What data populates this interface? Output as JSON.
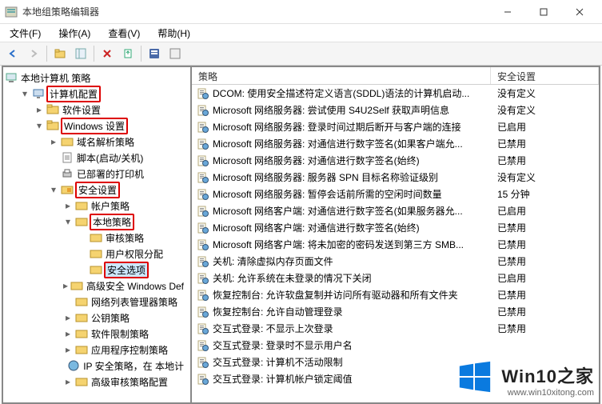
{
  "titlebar": {
    "text": "本地组策略编辑器"
  },
  "menubar": {
    "file": "文件(F)",
    "action": "操作(A)",
    "view": "查看(V)",
    "help": "帮助(H)"
  },
  "tree": {
    "root": "本地计算机 策略",
    "computerCfg": "计算机配置",
    "software": "软件设置",
    "windows": "Windows 设置",
    "dnsPolicy": "域名解析策略",
    "scripts": "脚本(启动/关机)",
    "printers": "已部署的打印机",
    "security": "安全设置",
    "accountPol": "帐户策略",
    "localPol": "本地策略",
    "auditPol": "审核策略",
    "userRights": "用户权限分配",
    "secOptions": "安全选项",
    "wfas": "高级安全 Windows Def",
    "netlist": "网络列表管理器策略",
    "pubkey": "公钥策略",
    "swRestrict": "软件限制策略",
    "appCtrl": "应用程序控制策略",
    "ipsec": "IP 安全策略，在 本地计",
    "advAudit": "高级审核策略配置"
  },
  "listHeader": {
    "name": "策略",
    "security": "安全设置"
  },
  "policies": [
    {
      "name": "DCOM: 使用安全描述符定义语言(SDDL)语法的计算机启动...",
      "val": "没有定义"
    },
    {
      "name": "Microsoft 网络服务器: 尝试使用 S4U2Self 获取声明信息",
      "val": "没有定义"
    },
    {
      "name": "Microsoft 网络服务器: 登录时间过期后断开与客户端的连接",
      "val": "已启用"
    },
    {
      "name": "Microsoft 网络服务器: 对通信进行数字签名(如果客户端允...",
      "val": "已禁用"
    },
    {
      "name": "Microsoft 网络服务器: 对通信进行数字签名(始终)",
      "val": "已禁用"
    },
    {
      "name": "Microsoft 网络服务器: 服务器 SPN 目标名称验证级别",
      "val": "没有定义"
    },
    {
      "name": "Microsoft 网络服务器: 暂停会话前所需的空闲时间数量",
      "val": "15 分钟"
    },
    {
      "name": "Microsoft 网络客户端: 对通信进行数字签名(如果服务器允...",
      "val": "已启用"
    },
    {
      "name": "Microsoft 网络客户端: 对通信进行数字签名(始终)",
      "val": "已禁用"
    },
    {
      "name": "Microsoft 网络客户端: 将未加密的密码发送到第三方 SMB...",
      "val": "已禁用"
    },
    {
      "name": "关机: 清除虚拟内存页面文件",
      "val": "已禁用"
    },
    {
      "name": "关机: 允许系统在未登录的情况下关闭",
      "val": "已启用"
    },
    {
      "name": "恢复控制台: 允许软盘复制并访问所有驱动器和所有文件夹",
      "val": "已禁用"
    },
    {
      "name": "恢复控制台: 允许自动管理登录",
      "val": "已禁用"
    },
    {
      "name": "交互式登录: 不显示上次登录",
      "val": "已禁用"
    },
    {
      "name": "交互式登录: 登录时不显示用户名",
      "val": ""
    },
    {
      "name": "交互式登录: 计算机不活动限制",
      "val": ""
    },
    {
      "name": "交互式登录: 计算机帐户锁定阈值",
      "val": ""
    }
  ],
  "watermark": {
    "title": "Win10之家",
    "url": "www.win10xitong.com"
  }
}
